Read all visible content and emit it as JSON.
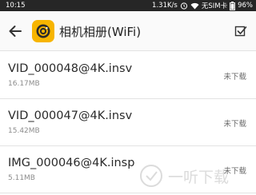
{
  "status_bar": {
    "time": "10:15",
    "network_speed": "1.31K/s",
    "carrier": "无SIM卡",
    "battery": "96%"
  },
  "app_bar": {
    "title": "相机相册(WiFi)",
    "back_icon": "arrow-left-icon",
    "select_icon": "checkbox-icon",
    "logo_icon": "camera-lens-icon",
    "logo_color": "#f7b500"
  },
  "files": [
    {
      "name": "VID_000048@4K.insv",
      "size": "16.17MB",
      "status": "未下载"
    },
    {
      "name": "VID_000047@4K.insv",
      "size": "15.42MB",
      "status": "未下载"
    },
    {
      "name": "IMG_000046@4K.insp",
      "size": "5.11MB",
      "status": "未下载"
    }
  ],
  "watermark": {
    "text": "一听下载"
  }
}
